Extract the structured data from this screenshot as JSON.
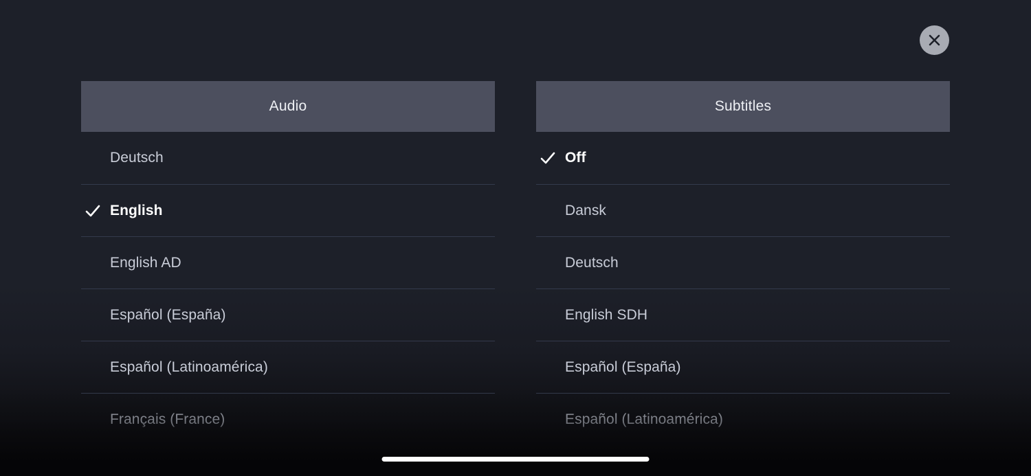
{
  "dialog": {
    "close_button": {
      "label": "Close",
      "icon": "close-icon"
    },
    "check_icon": "check-icon",
    "colors": {
      "background": "#1d2029",
      "tab_header": "#4c4f5e",
      "separator": "#343a4c",
      "option_text": "#c9cdd8",
      "selected_text": "#ffffff",
      "close_button": "#a8abb3",
      "home_indicator": "#ffffff"
    },
    "columns": [
      {
        "title": "Audio",
        "options": [
          {
            "label": "Deutsch",
            "selected": false
          },
          {
            "label": "English",
            "selected": true
          },
          {
            "label": "English AD",
            "selected": false
          },
          {
            "label": "Español (España)",
            "selected": false
          },
          {
            "label": "Español (Latinoamérica)",
            "selected": false
          },
          {
            "label": "Français (France)",
            "selected": false
          }
        ]
      },
      {
        "title": "Subtitles",
        "options": [
          {
            "label": "Off",
            "selected": true
          },
          {
            "label": "Dansk",
            "selected": false
          },
          {
            "label": "Deutsch",
            "selected": false
          },
          {
            "label": "English SDH",
            "selected": false
          },
          {
            "label": "Español (España)",
            "selected": false
          },
          {
            "label": "Español (Latinoamérica)",
            "selected": false
          }
        ]
      }
    ],
    "home_indicator": "home-indicator"
  }
}
